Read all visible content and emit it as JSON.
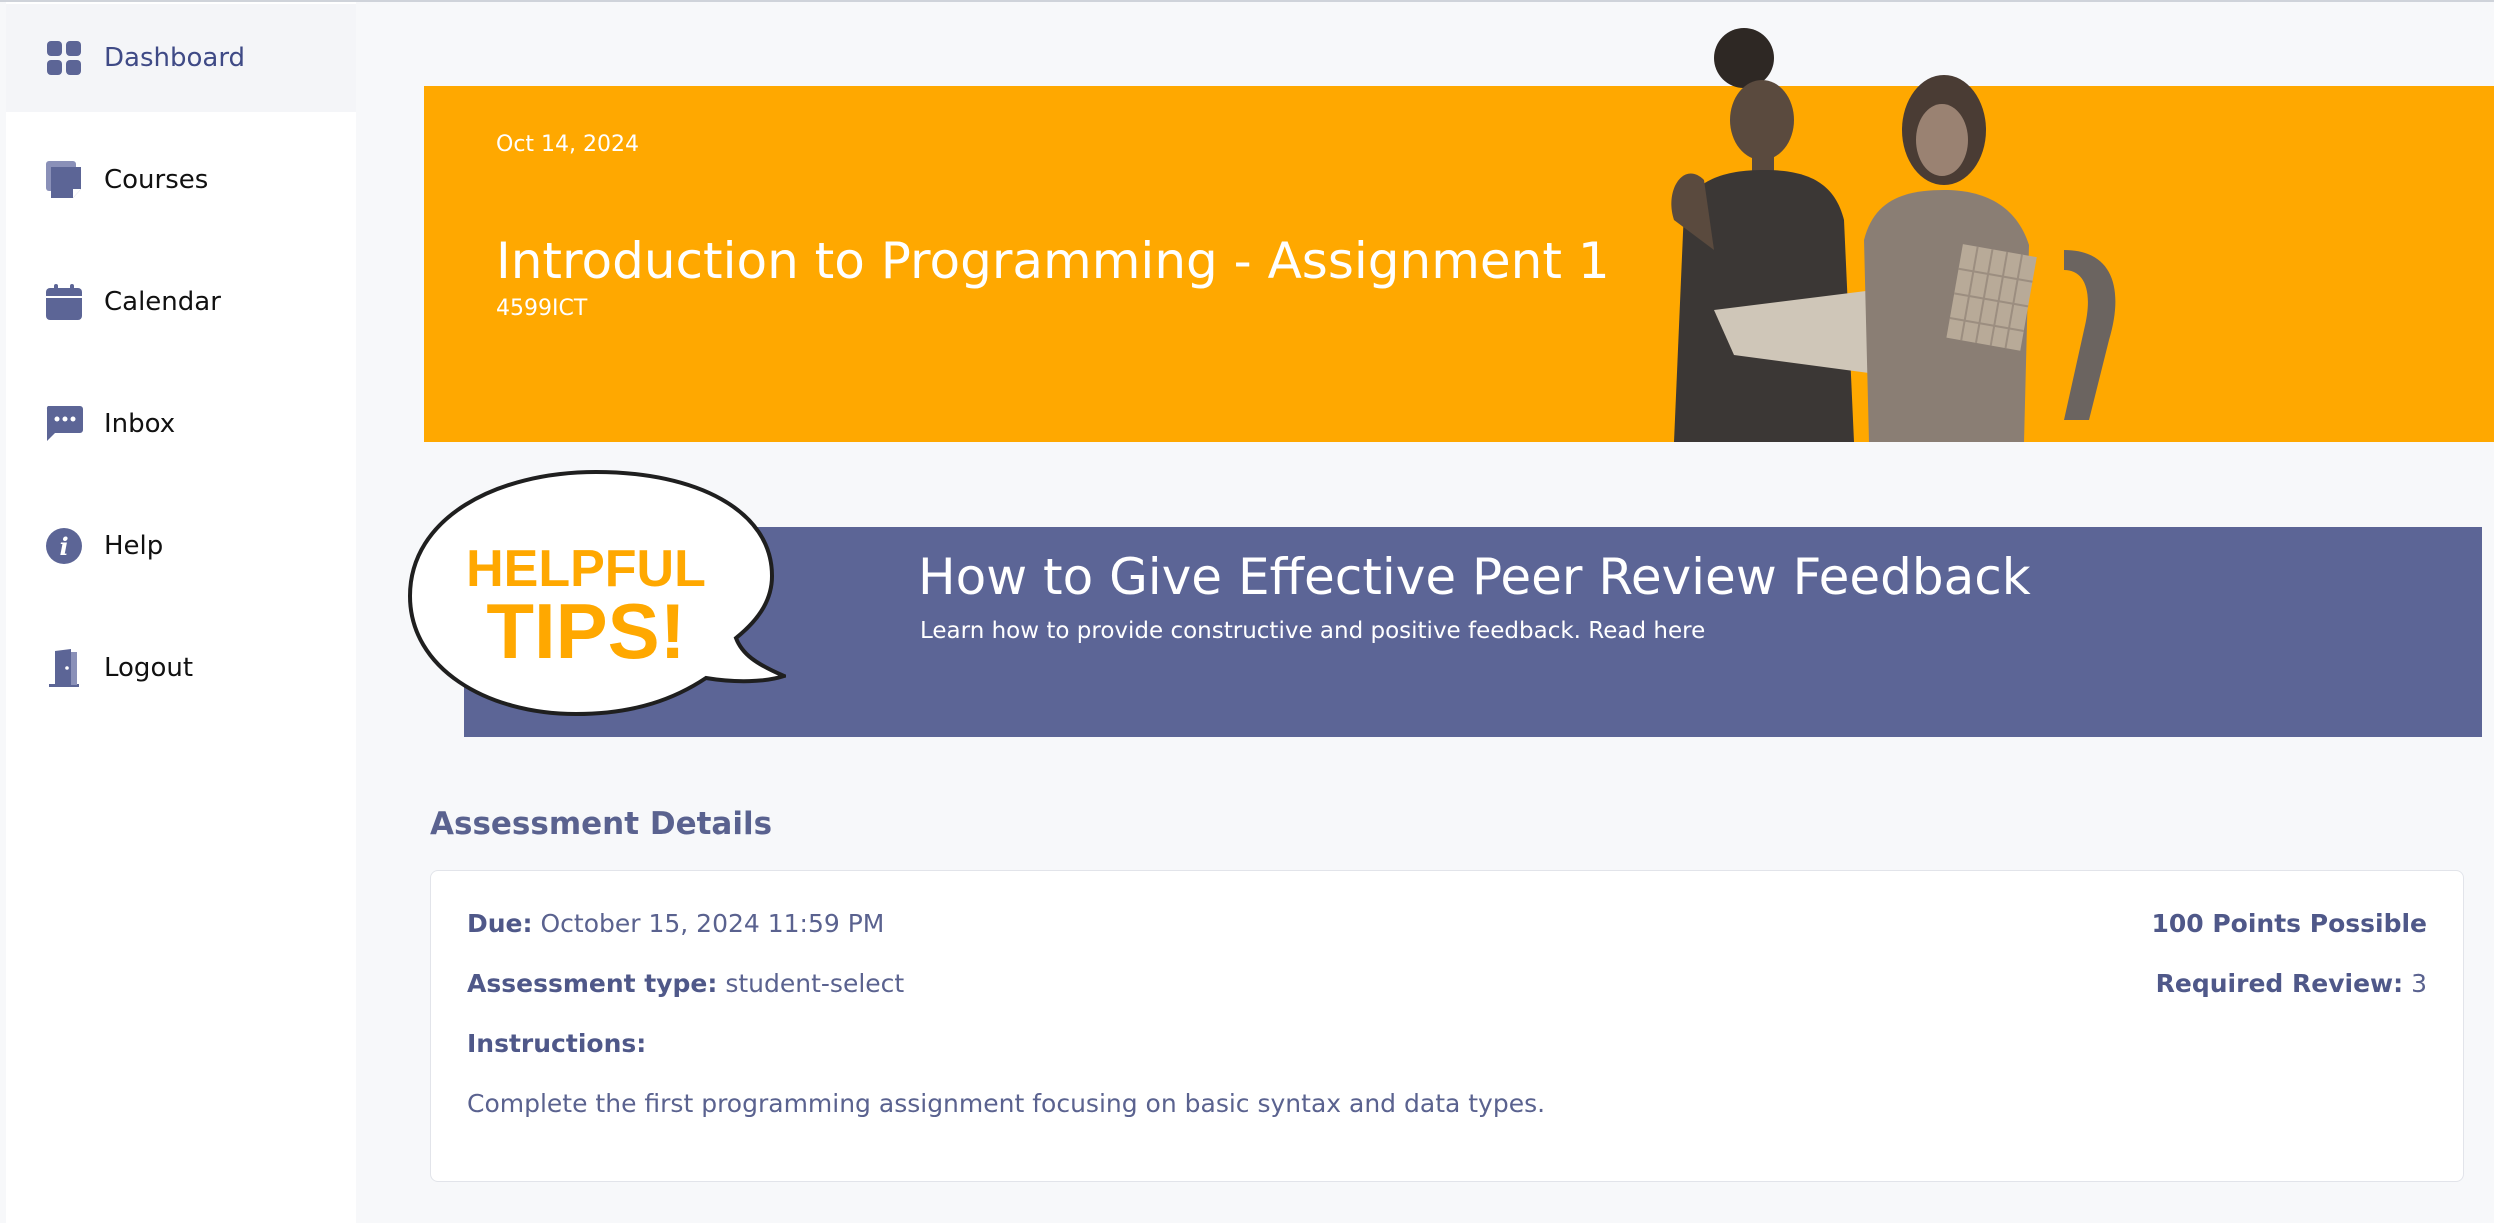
{
  "sidebar": {
    "items": [
      {
        "label": "Dashboard",
        "icon": "grid-icon",
        "active": true
      },
      {
        "label": "Courses",
        "icon": "courses-icon"
      },
      {
        "label": "Calendar",
        "icon": "calendar-icon"
      },
      {
        "label": "Inbox",
        "icon": "chat-icon"
      },
      {
        "label": "Help",
        "icon": "info-icon"
      },
      {
        "label": "Logout",
        "icon": "door-icon"
      }
    ]
  },
  "hero": {
    "date": "Oct 14, 2024",
    "title": "Introduction to Programming - Assignment 1",
    "code": "4599ICT",
    "bg_color": "#ffa800"
  },
  "tips": {
    "bubble_line1": "HELPFUL",
    "bubble_line2": "TIPS!",
    "title": "How to Give Effective Peer Review Feedback",
    "subtitle": "Learn how to provide constructive and positive feedback. Read here",
    "bg_color": "#5c6596"
  },
  "assessment": {
    "section_title": "Assessment Details",
    "due_label": "Due:",
    "due_value": "October 15, 2024 11:59 PM",
    "type_label": "Assessment type:",
    "type_value": "student-select",
    "instructions_label": "Instructions:",
    "instructions_text": "Complete the first programming assignment focusing on basic syntax and data types.",
    "points": "100 Points Possible",
    "review_label": "Required Review:",
    "review_value": "3"
  }
}
